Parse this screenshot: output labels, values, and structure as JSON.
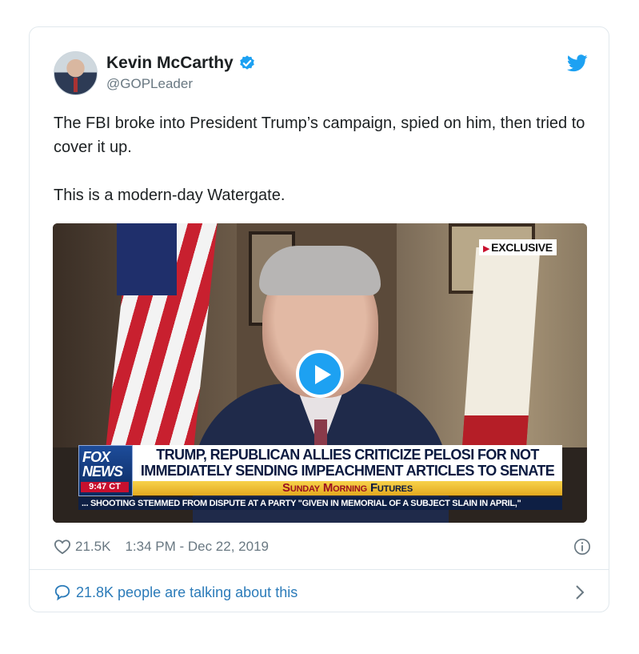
{
  "tweet": {
    "author": {
      "display_name": "Kevin McCarthy",
      "handle": "@GOPLeader",
      "verified_icon": "verified-badge-icon",
      "avatar": "avatar-photo"
    },
    "text": "The FBI broke into President Trump’s campaign, spied on him, then tried to cover it up.\n\nThis is a modern-day Watergate.",
    "media": {
      "type": "video",
      "badge": "EXCLUSIVE",
      "network_logo_line1": "FOX",
      "network_logo_line2": "NEWS",
      "time_stamp": "9:47 CT",
      "headline_line1": "TRUMP, REPUBLICAN ALLIES CRITICIZE PELOSI FOR NOT",
      "headline_line2": "IMMEDIATELY SENDING IMPEACHMENT ARTICLES TO SENATE",
      "show_name_part1": "Sunday Morning",
      "show_name_part2": "Futures",
      "ticker": "... SHOOTING STEMMED FROM DISPUTE AT A PARTY \"GIVEN IN MEMORIAL OF A SUBJECT SLAIN IN APRIL,\""
    },
    "likes": "21.5K",
    "timestamp": "1:34 PM - Dec 22, 2019",
    "talking": "21.8K people are talking about this"
  },
  "colors": {
    "brand_blue": "#1da1f2",
    "link_blue": "#2b7bb9",
    "meta_gray": "#697882",
    "border": "#e1e8ed"
  }
}
